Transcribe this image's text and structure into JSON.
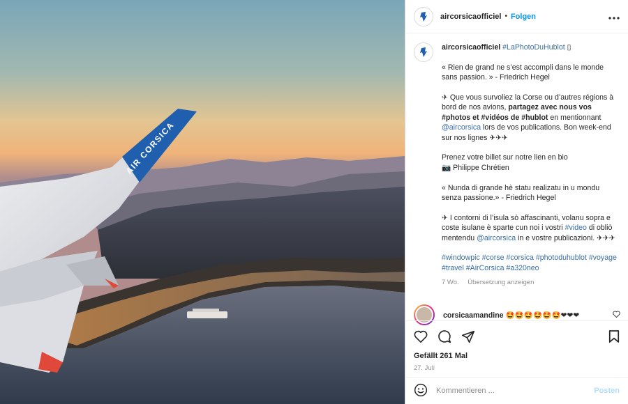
{
  "post": {
    "username": "aircorsicaofficiel",
    "dot": "•",
    "follow_label": "Folgen",
    "more_label": "•••",
    "image_text": {
      "wing_logo": "AIR CORSICA"
    }
  },
  "caption": {
    "username": "aircorsicaofficiel",
    "hashtag_title": "#LaPhotoDuHublot",
    "title_glyph": "▯",
    "p1": "« Rien de grand ne s’est accompli dans le monde sans passion. » - Friedrich Hegel",
    "p2_a": "✈ Que vous survoliez la Corse ou d’autres régions à bord de nos avions, ",
    "p2_bold": "partagez avec nous vos #photos et #vidéos de #hublot",
    "p2_b": " en mentionnant ",
    "p2_mention": "@aircorsica",
    "p2_c": " lors de vos publications. Bon week-end sur nos lignes ✈✈✈",
    "p3_a": "Prenez votre billet sur notre lien en bio",
    "p3_b": "📷 Philippe Chrétien",
    "p4": "« Nunda di grande hè statu realizatu in u mondu senza passione.» - Friedrich Hegel",
    "p5_a": "✈ I contorni di l’isula sò affascinanti, volanu sopra e coste isulane è sparte cun noi i vostri ",
    "p5_tag": "#video",
    "p5_b": " di obliò mentendu ",
    "p5_mention": "@aircorsica",
    "p5_c": " in e vostre publicazioni. ✈✈✈",
    "tags_line": "#windowpic #corse #corsica #photoduhublot #voyage #travel #AirCorsica #a320neo",
    "age": "7 Wo.",
    "translate": "Übersetzung anzeigen"
  },
  "comment": {
    "username": "corsicaamandine",
    "text": "🤩🤩🤩🤩🤩🤩❤❤❤"
  },
  "actions": {
    "likes": "Gefällt 261 Mal",
    "date": "27. Juli"
  },
  "comment_input": {
    "placeholder": "Kommentieren ...",
    "post_label": "Posten"
  },
  "colors": {
    "accent": "#0095f6",
    "hashtag": "#3a6ea5",
    "wing_blue": "#1f5fae",
    "wing_tip": "#e0483a"
  }
}
